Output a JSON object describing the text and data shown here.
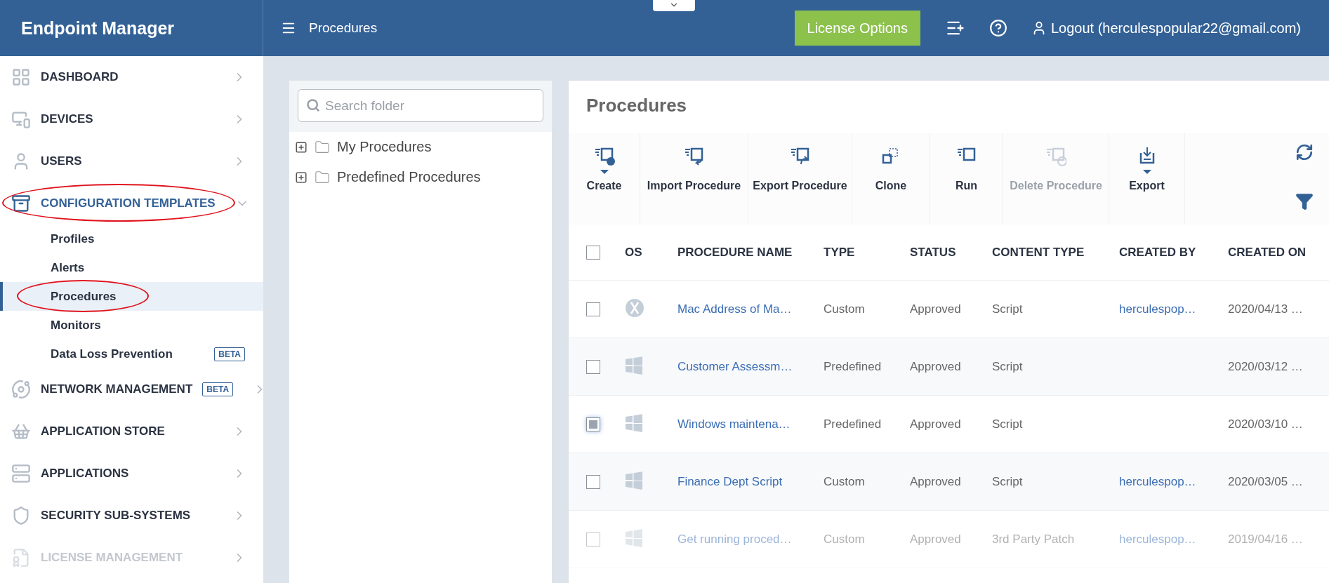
{
  "header": {
    "title": "Endpoint Manager",
    "breadcrumb": "Procedures",
    "license_button": "License Options",
    "user": "Logout (herculespopular22@gmail.com)"
  },
  "sidebar": {
    "items": [
      {
        "label": "DASHBOARD",
        "expanded": false,
        "disabled": false,
        "circled": false
      },
      {
        "label": "DEVICES",
        "expanded": false,
        "disabled": false,
        "circled": false
      },
      {
        "label": "USERS",
        "expanded": false,
        "disabled": false,
        "circled": false
      },
      {
        "label": "CONFIGURATION TEMPLATES",
        "expanded": true,
        "disabled": false,
        "circled": true,
        "children": [
          {
            "label": "Profiles",
            "selected": false,
            "circled": false
          },
          {
            "label": "Alerts",
            "selected": false,
            "circled": false
          },
          {
            "label": "Procedures",
            "selected": true,
            "circled": true
          },
          {
            "label": "Monitors",
            "selected": false,
            "circled": false
          },
          {
            "label": "Data Loss Prevention",
            "selected": false,
            "circled": false,
            "badge": "BETA"
          }
        ]
      },
      {
        "label": "NETWORK MANAGEMENT",
        "expanded": false,
        "disabled": false,
        "circled": false,
        "badge": "BETA"
      },
      {
        "label": "APPLICATION STORE",
        "expanded": false,
        "disabled": false,
        "circled": false
      },
      {
        "label": "APPLICATIONS",
        "expanded": false,
        "disabled": false,
        "circled": false
      },
      {
        "label": "SECURITY SUB-SYSTEMS",
        "expanded": false,
        "disabled": false,
        "circled": false
      },
      {
        "label": "LICENSE MANAGEMENT",
        "expanded": false,
        "disabled": true,
        "circled": false
      }
    ]
  },
  "folders": {
    "search": {
      "placeholder": "Search folder"
    },
    "items": [
      {
        "label": "My Procedures",
        "expanded": false
      },
      {
        "label": "Predefined Procedures",
        "expanded": false
      }
    ]
  },
  "procedures": {
    "title": "Procedures",
    "toolbar": [
      {
        "label": "Create",
        "menu": true,
        "disabled": false
      },
      {
        "label": "Import Procedure",
        "menu": false,
        "disabled": false
      },
      {
        "label": "Export Procedure",
        "menu": false,
        "disabled": false
      },
      {
        "label": "Clone",
        "menu": false,
        "disabled": false
      },
      {
        "label": "Run",
        "menu": false,
        "disabled": false
      },
      {
        "label": "Delete Procedure",
        "menu": false,
        "disabled": true
      },
      {
        "label": "Export",
        "menu": true,
        "disabled": false
      }
    ],
    "table": {
      "select_all": {
        "checked": false
      },
      "columns": [
        "OS",
        "PROCEDURE NAME",
        "TYPE",
        "STATUS",
        "CONTENT TYPE",
        "CREATED BY",
        "CREATED ON"
      ],
      "rows": [
        {
          "checked": false,
          "disabled": false,
          "kind": "mac",
          "name": "Mac Address of Ma…",
          "type": "Custom",
          "status": "Approved",
          "content_type": "Script",
          "created_by": "herculespop…",
          "created_on": "2020/04/13 …"
        },
        {
          "checked": false,
          "disabled": false,
          "kind": "windows",
          "name": "Customer Assessm…",
          "type": "Predefined",
          "status": "Approved",
          "content_type": "Script",
          "created_on": "2020/03/12 …"
        },
        {
          "checked": true,
          "disabled": false,
          "kind": "windows",
          "name": "Windows maintena…",
          "type": "Predefined",
          "status": "Approved",
          "content_type": "Script",
          "created_on": "2020/03/10 …"
        },
        {
          "checked": false,
          "disabled": false,
          "kind": "windows",
          "name": "Finance Dept Script",
          "type": "Custom",
          "status": "Approved",
          "content_type": "Script",
          "created_by": "herculespop…",
          "created_on": "2020/03/05 …"
        },
        {
          "checked": false,
          "disabled": true,
          "kind": "windows",
          "name": "Get running proced…",
          "type": "Custom",
          "status": "Approved",
          "content_type": "3rd Party Patch",
          "created_by": "herculespop…",
          "created_on": "2019/04/16 …"
        }
      ]
    }
  }
}
